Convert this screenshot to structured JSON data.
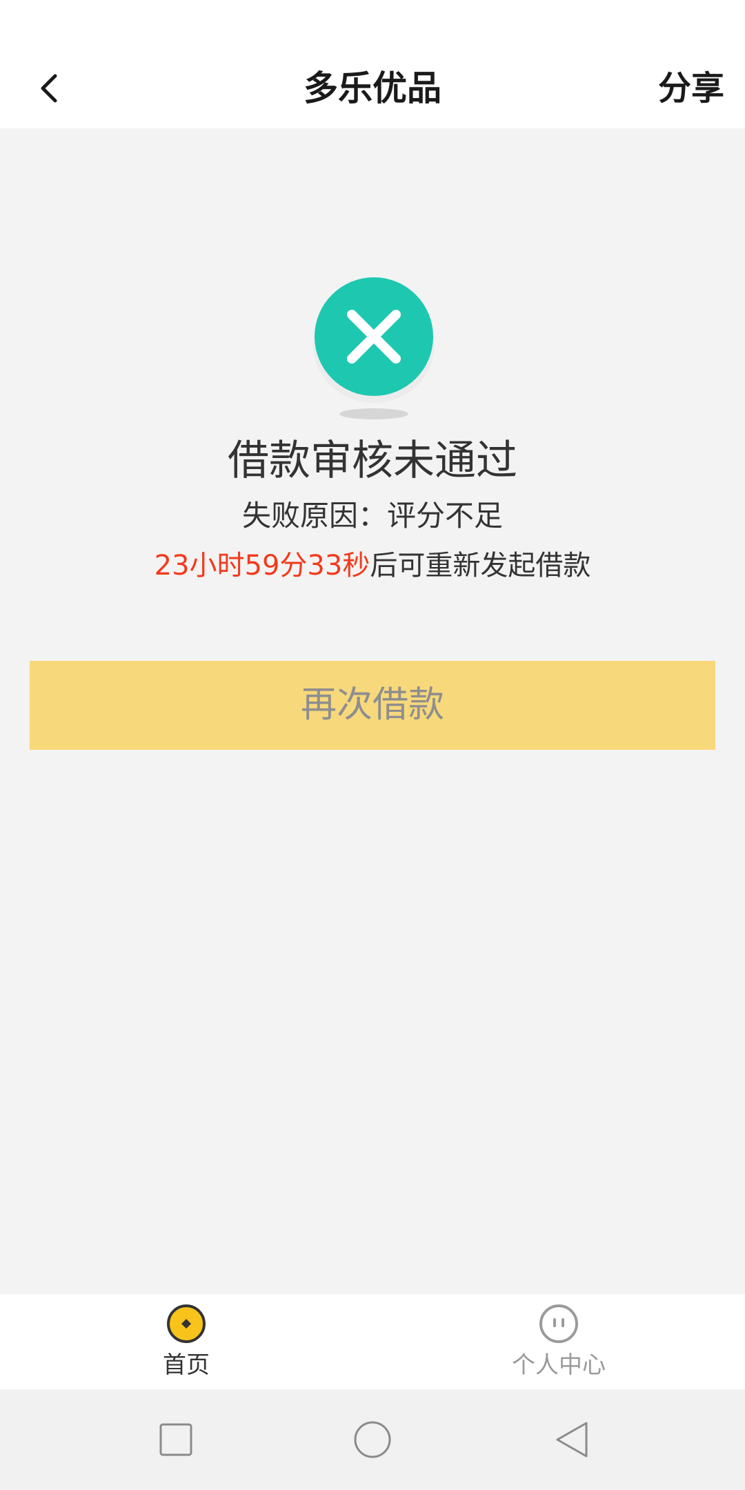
{
  "header": {
    "title": "多乐优品",
    "share_label": "分享"
  },
  "result": {
    "icon": "close-circle-icon",
    "accent_color": "#1ec8b0",
    "title": "借款审核未通过",
    "reason": "失败原因：评分不足",
    "countdown": "23小时59分33秒",
    "countdown_suffix": "后可重新发起借款",
    "countdown_color": "#f23a1c"
  },
  "actions": {
    "retry_label": "再次借款",
    "retry_bg": "#f7d87b"
  },
  "tabs": [
    {
      "label": "首页",
      "icon": "home-coin-icon",
      "active": true
    },
    {
      "label": "个人中心",
      "icon": "profile-face-icon",
      "active": false
    }
  ],
  "system_nav": [
    "recents-icon",
    "home-icon",
    "back-icon"
  ]
}
